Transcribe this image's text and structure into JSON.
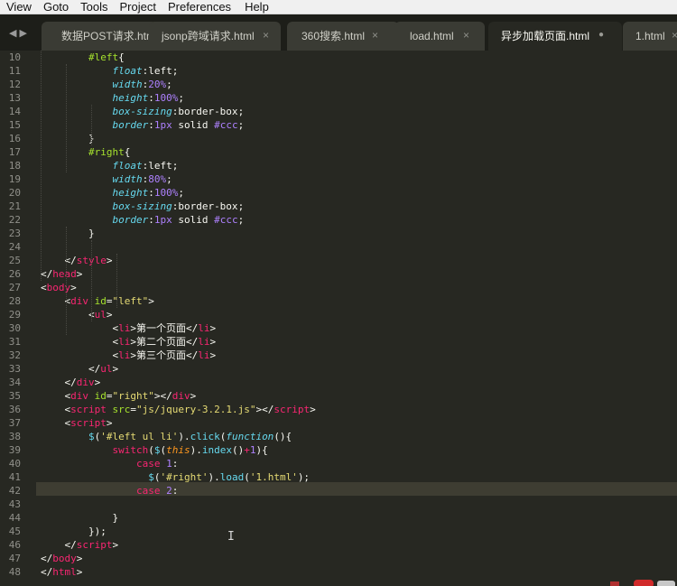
{
  "menu": [
    {
      "id": "view",
      "label": "View"
    },
    {
      "id": "goto",
      "label": "Goto"
    },
    {
      "id": "tools",
      "label": "Tools"
    },
    {
      "id": "project",
      "label": "Project"
    },
    {
      "id": "preferences",
      "label": "Preferences"
    },
    {
      "id": "help",
      "label": "Help"
    }
  ],
  "tabs": [
    {
      "label": "数据POST请求.html",
      "close": "",
      "active": false,
      "modified": false
    },
    {
      "label": "jsonp跨域请求.html",
      "close": "×",
      "active": false,
      "modified": false
    },
    {
      "label": "360搜索.html",
      "close": "×",
      "active": false,
      "modified": false
    },
    {
      "label": "load.html",
      "close": "×",
      "active": false,
      "modified": false
    },
    {
      "label": "异步加载页面.html",
      "close": "●",
      "active": true,
      "modified": true
    },
    {
      "label": "1.html",
      "close": "×",
      "active": false,
      "modified": false
    }
  ],
  "tab_nav": {
    "prev": "◀",
    "next": "▶"
  },
  "editor": {
    "theme_colors": {
      "background": "#272822",
      "tag": "#f92672",
      "attr": "#a6e22e",
      "string": "#e6db74",
      "number": "#ae81ff",
      "property": "#66d9ef"
    },
    "current_line": 42,
    "lines": [
      {
        "n": "10",
        "tokens": [
          [
            "t-sel",
            "        #left"
          ],
          [
            "t-txt",
            "{"
          ]
        ]
      },
      {
        "n": "11",
        "tokens": [
          [
            "t-prop",
            "            float"
          ],
          [
            "t-txt",
            ":"
          ],
          [
            "t-val",
            "left"
          ],
          [
            "t-txt",
            ";"
          ]
        ]
      },
      {
        "n": "12",
        "tokens": [
          [
            "t-prop",
            "            width"
          ],
          [
            "t-txt",
            ":"
          ],
          [
            "t-num",
            "20%"
          ],
          [
            "t-txt",
            ";"
          ]
        ]
      },
      {
        "n": "13",
        "tokens": [
          [
            "t-prop",
            "            height"
          ],
          [
            "t-txt",
            ":"
          ],
          [
            "t-num",
            "100%"
          ],
          [
            "t-txt",
            ";"
          ]
        ]
      },
      {
        "n": "14",
        "tokens": [
          [
            "t-prop",
            "            box-sizing"
          ],
          [
            "t-txt",
            ":"
          ],
          [
            "t-val",
            "border-box"
          ],
          [
            "t-txt",
            ";"
          ]
        ]
      },
      {
        "n": "15",
        "tokens": [
          [
            "t-prop",
            "            border"
          ],
          [
            "t-txt",
            ":"
          ],
          [
            "t-num",
            "1px"
          ],
          [
            "t-val",
            " solid "
          ],
          [
            "t-num",
            "#ccc"
          ],
          [
            "t-txt",
            ";"
          ]
        ]
      },
      {
        "n": "16",
        "tokens": [
          [
            "t-txt",
            "        }"
          ]
        ]
      },
      {
        "n": "17",
        "tokens": [
          [
            "t-sel",
            "        #right"
          ],
          [
            "t-txt",
            "{"
          ]
        ]
      },
      {
        "n": "18",
        "tokens": [
          [
            "t-prop",
            "            float"
          ],
          [
            "t-txt",
            ":"
          ],
          [
            "t-val",
            "left"
          ],
          [
            "t-txt",
            ";"
          ]
        ]
      },
      {
        "n": "19",
        "tokens": [
          [
            "t-prop",
            "            width"
          ],
          [
            "t-txt",
            ":"
          ],
          [
            "t-num",
            "80%"
          ],
          [
            "t-txt",
            ";"
          ]
        ]
      },
      {
        "n": "20",
        "tokens": [
          [
            "t-prop",
            "            height"
          ],
          [
            "t-txt",
            ":"
          ],
          [
            "t-num",
            "100%"
          ],
          [
            "t-txt",
            ";"
          ]
        ]
      },
      {
        "n": "21",
        "tokens": [
          [
            "t-prop",
            "            box-sizing"
          ],
          [
            "t-txt",
            ":"
          ],
          [
            "t-val",
            "border-box"
          ],
          [
            "t-txt",
            ";"
          ]
        ]
      },
      {
        "n": "22",
        "tokens": [
          [
            "t-prop",
            "            border"
          ],
          [
            "t-txt",
            ":"
          ],
          [
            "t-num",
            "1px"
          ],
          [
            "t-val",
            " solid "
          ],
          [
            "t-num",
            "#ccc"
          ],
          [
            "t-txt",
            ";"
          ]
        ]
      },
      {
        "n": "23",
        "tokens": [
          [
            "t-txt",
            "        }"
          ]
        ]
      },
      {
        "n": "24",
        "tokens": []
      },
      {
        "n": "25",
        "tokens": [
          [
            "t-txt",
            "    </"
          ],
          [
            "t-tag",
            "style"
          ],
          [
            "t-txt",
            ">"
          ]
        ]
      },
      {
        "n": "26",
        "tokens": [
          [
            "t-txt",
            "</"
          ],
          [
            "t-tag",
            "head"
          ],
          [
            "t-txt",
            ">"
          ]
        ]
      },
      {
        "n": "27",
        "tokens": [
          [
            "t-txt",
            "<"
          ],
          [
            "t-tag",
            "body"
          ],
          [
            "t-txt",
            ">"
          ]
        ]
      },
      {
        "n": "28",
        "tokens": [
          [
            "t-txt",
            "    <"
          ],
          [
            "t-tag",
            "div"
          ],
          [
            "t-attr",
            " id"
          ],
          [
            "t-txt",
            "="
          ],
          [
            "t-str",
            "\"left\""
          ],
          [
            "t-txt",
            ">"
          ]
        ]
      },
      {
        "n": "29",
        "tokens": [
          [
            "t-txt",
            "        <"
          ],
          [
            "t-tag",
            "ul"
          ],
          [
            "t-txt",
            ">"
          ]
        ]
      },
      {
        "n": "30",
        "tokens": [
          [
            "t-txt",
            "            <"
          ],
          [
            "t-tag",
            "li"
          ],
          [
            "t-txt",
            ">"
          ],
          [
            "t-txt t-cn",
            "第一个页面"
          ],
          [
            "t-txt",
            "</"
          ],
          [
            "t-tag",
            "li"
          ],
          [
            "t-txt",
            ">"
          ]
        ]
      },
      {
        "n": "31",
        "tokens": [
          [
            "t-txt",
            "            <"
          ],
          [
            "t-tag",
            "li"
          ],
          [
            "t-txt",
            ">"
          ],
          [
            "t-txt t-cn",
            "第二个页面"
          ],
          [
            "t-txt",
            "</"
          ],
          [
            "t-tag",
            "li"
          ],
          [
            "t-txt",
            ">"
          ]
        ]
      },
      {
        "n": "32",
        "tokens": [
          [
            "t-txt",
            "            <"
          ],
          [
            "t-tag",
            "li"
          ],
          [
            "t-txt",
            ">"
          ],
          [
            "t-txt t-cn",
            "第三个页面"
          ],
          [
            "t-txt",
            "</"
          ],
          [
            "t-tag",
            "li"
          ],
          [
            "t-txt",
            ">"
          ]
        ]
      },
      {
        "n": "33",
        "tokens": [
          [
            "t-txt",
            "        </"
          ],
          [
            "t-tag",
            "ul"
          ],
          [
            "t-txt",
            ">"
          ]
        ]
      },
      {
        "n": "34",
        "tokens": [
          [
            "t-txt",
            "    </"
          ],
          [
            "t-tag",
            "div"
          ],
          [
            "t-txt",
            ">"
          ]
        ]
      },
      {
        "n": "35",
        "tokens": [
          [
            "t-txt",
            "    <"
          ],
          [
            "t-tag",
            "div"
          ],
          [
            "t-attr",
            " id"
          ],
          [
            "t-txt",
            "="
          ],
          [
            "t-str",
            "\"right\""
          ],
          [
            "t-txt",
            "></"
          ],
          [
            "t-tag",
            "div"
          ],
          [
            "t-txt",
            ">"
          ]
        ]
      },
      {
        "n": "36",
        "tokens": [
          [
            "t-txt",
            "    <"
          ],
          [
            "t-tag",
            "script"
          ],
          [
            "t-attr",
            " src"
          ],
          [
            "t-txt",
            "="
          ],
          [
            "t-str",
            "\"js/jquery-3.2.1.js\""
          ],
          [
            "t-txt",
            "></"
          ],
          [
            "t-tag",
            "script"
          ],
          [
            "t-txt",
            ">"
          ]
        ]
      },
      {
        "n": "37",
        "tokens": [
          [
            "t-txt",
            "    <"
          ],
          [
            "t-tag",
            "script"
          ],
          [
            "t-txt",
            ">"
          ]
        ]
      },
      {
        "n": "38",
        "tokens": [
          [
            "t-fn",
            "        $"
          ],
          [
            "t-txt",
            "("
          ],
          [
            "t-str",
            "'#left ul li'"
          ],
          [
            "t-txt",
            ")."
          ],
          [
            "t-fn",
            "click"
          ],
          [
            "t-txt",
            "("
          ],
          [
            "t-func",
            "function"
          ],
          [
            "t-txt",
            "(){"
          ]
        ]
      },
      {
        "n": "39",
        "tokens": [
          [
            "t-kw",
            "            switch"
          ],
          [
            "t-txt",
            "("
          ],
          [
            "t-fn",
            "$"
          ],
          [
            "t-txt",
            "("
          ],
          [
            "t-this",
            "this"
          ],
          [
            "t-txt",
            ")."
          ],
          [
            "t-fn",
            "index"
          ],
          [
            "t-txt",
            "()"
          ],
          [
            "t-kw",
            "+"
          ],
          [
            "t-num",
            "1"
          ],
          [
            "t-txt",
            "){"
          ]
        ]
      },
      {
        "n": "40",
        "tokens": [
          [
            "t-kw",
            "                case"
          ],
          [
            "t-txt",
            " "
          ],
          [
            "t-num",
            "1"
          ],
          [
            "t-txt",
            ":"
          ]
        ]
      },
      {
        "n": "41",
        "tokens": [
          [
            "t-fn",
            "                  $"
          ],
          [
            "t-txt",
            "("
          ],
          [
            "t-str",
            "'#right'"
          ],
          [
            "t-txt",
            ")."
          ],
          [
            "t-fn",
            "load"
          ],
          [
            "t-txt",
            "("
          ],
          [
            "t-str",
            "'1.html'"
          ],
          [
            "t-txt",
            ");"
          ]
        ]
      },
      {
        "n": "42",
        "tokens": [
          [
            "t-kw",
            "                case"
          ],
          [
            "t-txt",
            " "
          ],
          [
            "t-num",
            "2"
          ],
          [
            "t-txt",
            ":"
          ]
        ]
      },
      {
        "n": "43",
        "tokens": []
      },
      {
        "n": "44",
        "tokens": [
          [
            "t-txt",
            "            }"
          ]
        ]
      },
      {
        "n": "45",
        "tokens": [
          [
            "t-txt",
            "        });"
          ]
        ]
      },
      {
        "n": "46",
        "tokens": [
          [
            "t-txt",
            "    </"
          ],
          [
            "t-tag",
            "script"
          ],
          [
            "t-txt",
            ">"
          ]
        ]
      },
      {
        "n": "47",
        "tokens": [
          [
            "t-txt",
            "</"
          ],
          [
            "t-tag",
            "body"
          ],
          [
            "t-txt",
            ">"
          ]
        ]
      },
      {
        "n": "48",
        "tokens": [
          [
            "t-txt",
            "</"
          ],
          [
            "t-tag",
            "html"
          ],
          [
            "t-txt",
            ">"
          ]
        ]
      }
    ]
  },
  "cursor_glyph": "I"
}
